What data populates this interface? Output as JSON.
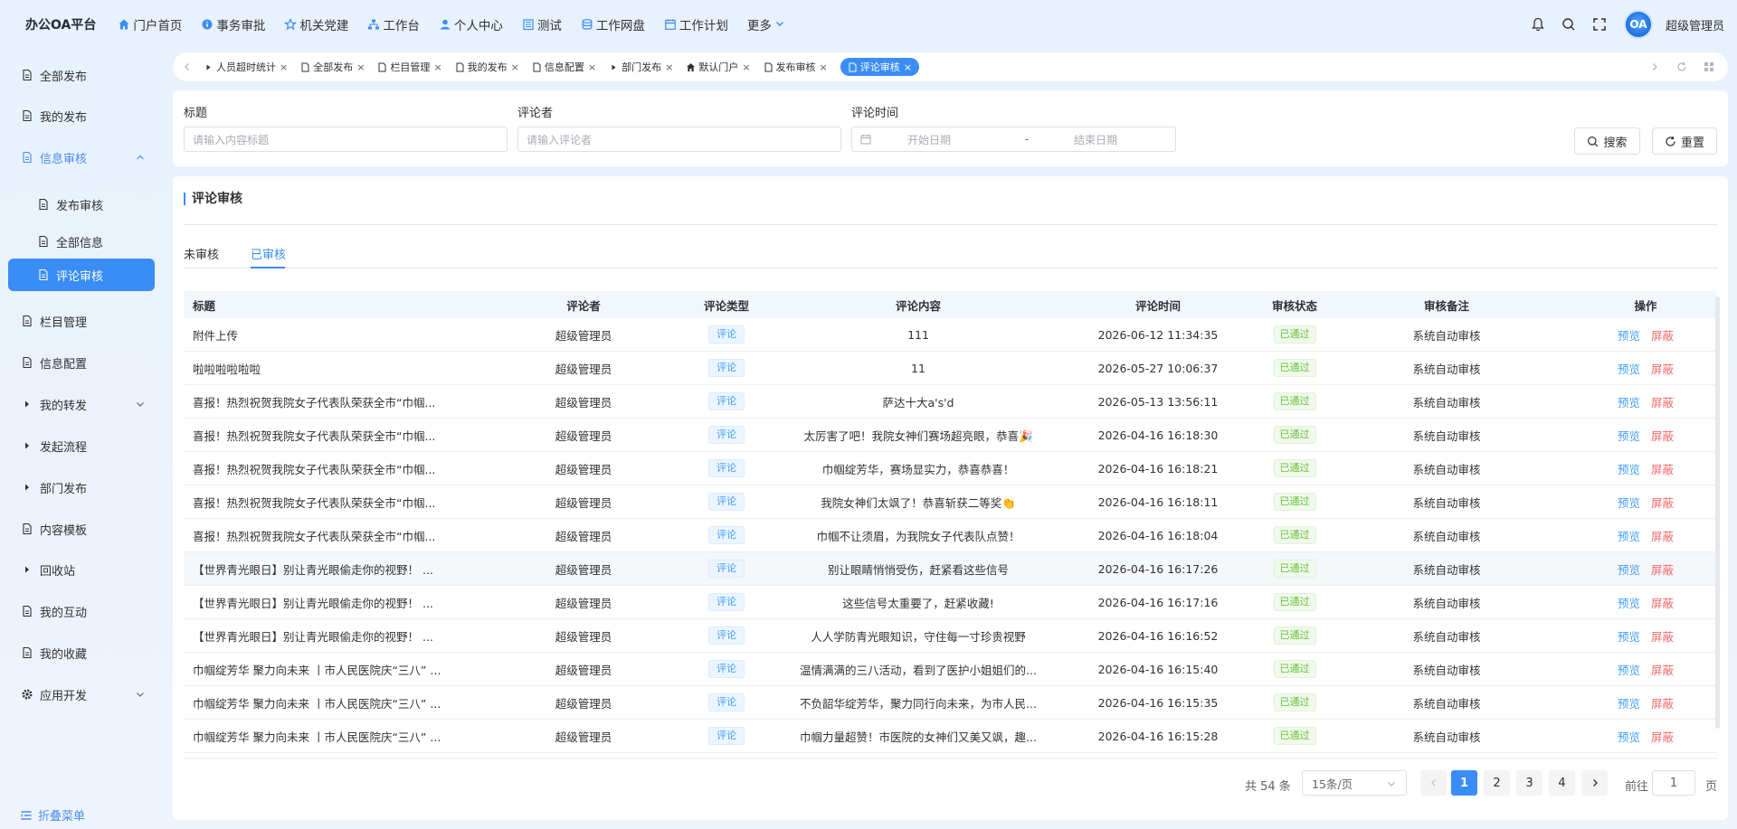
{
  "header": {
    "brand": "办公OA平台",
    "nav": [
      {
        "label": "门户首页",
        "icon": "home-icon"
      },
      {
        "label": "事务审批",
        "icon": "info-circle-icon"
      },
      {
        "label": "机关党建",
        "icon": "star-icon"
      },
      {
        "label": "工作台",
        "icon": "sitemap-icon"
      },
      {
        "label": "个人中心",
        "icon": "user-icon"
      },
      {
        "label": "测试",
        "icon": "building-icon"
      },
      {
        "label": "工作网盘",
        "icon": "database-icon"
      },
      {
        "label": "工作计划",
        "icon": "calendar-icon"
      },
      {
        "label": "更多",
        "icon": "chevron-down-icon"
      }
    ],
    "avatar_text": "OA",
    "username": "超级管理员"
  },
  "sidebar": {
    "items": [
      {
        "label": "全部发布"
      },
      {
        "label": "我的发布"
      },
      {
        "label": "信息审核"
      },
      {
        "label": "发布审核"
      },
      {
        "label": "全部信息"
      },
      {
        "label": "评论审核"
      },
      {
        "label": "栏目管理"
      },
      {
        "label": "信息配置"
      },
      {
        "label": "我的转发"
      },
      {
        "label": "发起流程"
      },
      {
        "label": "部门发布"
      },
      {
        "label": "内容模板"
      },
      {
        "label": "回收站"
      },
      {
        "label": "我的互动"
      },
      {
        "label": "我的收藏"
      },
      {
        "label": "应用开发"
      }
    ],
    "collapse_label": "折叠菜单"
  },
  "tabs": [
    {
      "label": "人员超时统计"
    },
    {
      "label": "全部发布"
    },
    {
      "label": "栏目管理"
    },
    {
      "label": "我的发布"
    },
    {
      "label": "信息配置"
    },
    {
      "label": "部门发布"
    },
    {
      "label": "默认门户"
    },
    {
      "label": "发布审核"
    },
    {
      "label": "评论审核"
    }
  ],
  "filters": {
    "title_label": "标题",
    "title_placeholder": "请输入内容标题",
    "commenter_label": "评论者",
    "commenter_placeholder": "请输入评论者",
    "time_label": "评论时间",
    "start_placeholder": "开始日期",
    "range_sep": "-",
    "end_placeholder": "结束日期",
    "search_label": "搜索",
    "reset_label": "重置"
  },
  "card": {
    "title": "评论审核",
    "subtabs": [
      "未审核",
      "已审核"
    ]
  },
  "table": {
    "headers": [
      "标题",
      "评论者",
      "评论类型",
      "评论内容",
      "评论时间",
      "审核状态",
      "审核备注",
      "操作"
    ],
    "rows": [
      {
        "title": "附件上传",
        "commenter": "超级管理员",
        "type": "评论",
        "content": "111",
        "time": "2026-06-12 11:34:35",
        "status": "已通过",
        "note": "系统自动审核",
        "op1": "预览",
        "op2": "屏蔽"
      },
      {
        "title": "啦啦啦啦啦啦",
        "commenter": "超级管理员",
        "type": "评论",
        "content": "11",
        "time": "2026-05-27 10:06:37",
        "status": "已通过",
        "note": "系统自动审核",
        "op1": "预览",
        "op2": "屏蔽"
      },
      {
        "title": "喜报！热烈祝贺我院女子代表队荣获全市“巾帼...",
        "commenter": "超级管理员",
        "type": "评论",
        "content": "萨达十大a's'd",
        "time": "2026-05-13 13:56:11",
        "status": "已通过",
        "note": "系统自动审核",
        "op1": "预览",
        "op2": "屏蔽"
      },
      {
        "title": "喜报！热烈祝贺我院女子代表队荣获全市“巾帼...",
        "commenter": "超级管理员",
        "type": "评论",
        "content": "太厉害了吧！我院女神们赛场超亮眼，恭喜🎉",
        "time": "2026-04-16 16:18:30",
        "status": "已通过",
        "note": "系统自动审核",
        "op1": "预览",
        "op2": "屏蔽"
      },
      {
        "title": "喜报！热烈祝贺我院女子代表队荣获全市“巾帼...",
        "commenter": "超级管理员",
        "type": "评论",
        "content": "巾帼绽芳华，赛场显实力，恭喜恭喜！",
        "time": "2026-04-16 16:18:21",
        "status": "已通过",
        "note": "系统自动审核",
        "op1": "预览",
        "op2": "屏蔽"
      },
      {
        "title": "喜报！热烈祝贺我院女子代表队荣获全市“巾帼...",
        "commenter": "超级管理员",
        "type": "评论",
        "content": "我院女神们太飒了！恭喜斩获二等奖👏",
        "time": "2026-04-16 16:18:11",
        "status": "已通过",
        "note": "系统自动审核",
        "op1": "预览",
        "op2": "屏蔽"
      },
      {
        "title": "喜报！热烈祝贺我院女子代表队荣获全市“巾帼...",
        "commenter": "超级管理员",
        "type": "评论",
        "content": "巾帼不让须眉，为我院女子代表队点赞！",
        "time": "2026-04-16 16:18:04",
        "status": "已通过",
        "note": "系统自动审核",
        "op1": "预览",
        "op2": "屏蔽"
      },
      {
        "title": "【世界青光眼日】别让青光眼偷走你的视野！ ...",
        "commenter": "超级管理员",
        "type": "评论",
        "content": "别让眼睛悄悄受伤，赶紧看这些信号",
        "time": "2026-04-16 16:17:26",
        "status": "已通过",
        "note": "系统自动审核",
        "op1": "预览",
        "op2": "屏蔽"
      },
      {
        "title": "【世界青光眼日】别让青光眼偷走你的视野！ ...",
        "commenter": "超级管理员",
        "type": "评论",
        "content": "这些信号太重要了，赶紧收藏!",
        "time": "2026-04-16 16:17:16",
        "status": "已通过",
        "note": "系统自动审核",
        "op1": "预览",
        "op2": "屏蔽"
      },
      {
        "title": "【世界青光眼日】别让青光眼偷走你的视野！ ...",
        "commenter": "超级管理员",
        "type": "评论",
        "content": "人人学防青光眼知识，守住每一寸珍贵视野",
        "time": "2026-04-16 16:16:52",
        "status": "已通过",
        "note": "系统自动审核",
        "op1": "预览",
        "op2": "屏蔽"
      },
      {
        "title": "巾帼绽芳华 聚力向未来 丨市人民医院庆“三八” ...",
        "commenter": "超级管理员",
        "type": "评论",
        "content": "温情满满的三八活动，看到了医护小姐姐们的...",
        "time": "2026-04-16 16:15:40",
        "status": "已通过",
        "note": "系统自动审核",
        "op1": "预览",
        "op2": "屏蔽"
      },
      {
        "title": "巾帼绽芳华 聚力向未来 丨市人民医院庆“三八” ...",
        "commenter": "超级管理员",
        "type": "评论",
        "content": "不负韶华绽芳华，聚力同行向未来，为市人民...",
        "time": "2026-04-16 16:15:35",
        "status": "已通过",
        "note": "系统自动审核",
        "op1": "预览",
        "op2": "屏蔽"
      },
      {
        "title": "巾帼绽芳华 聚力向未来 丨市人民医院庆“三八” ...",
        "commenter": "超级管理员",
        "type": "评论",
        "content": "巾帼力量超赞！市医院的女神们又美又飒，趣...",
        "time": "2026-04-16 16:15:28",
        "status": "已通过",
        "note": "系统自动审核",
        "op1": "预览",
        "op2": "屏蔽"
      }
    ]
  },
  "pagination": {
    "total": "共 54 条",
    "page_size": "15条/页",
    "pages": [
      "1",
      "2",
      "3",
      "4"
    ],
    "current": "1",
    "goto_label": "前往",
    "goto_value": "1",
    "page_unit": "页"
  },
  "colors": {
    "accent": "#3a8df5",
    "danger": "#f56c6c",
    "success": "#67c23a"
  }
}
